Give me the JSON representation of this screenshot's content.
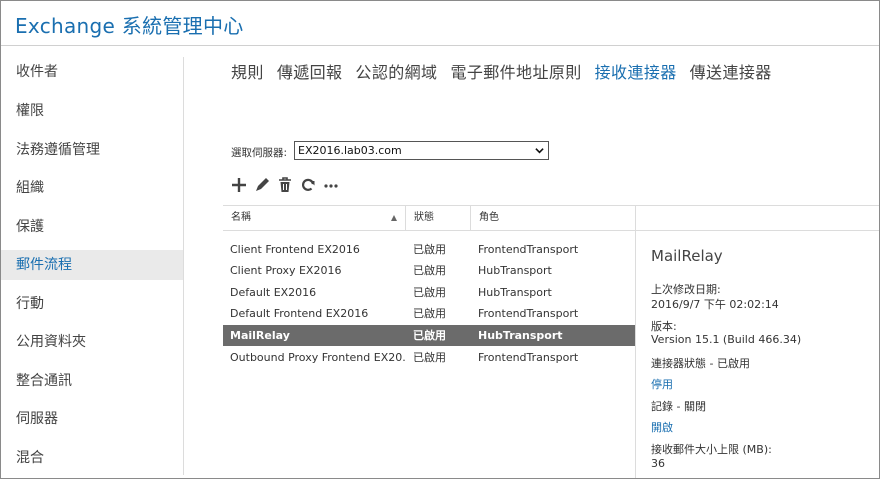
{
  "app": {
    "title": "Exchange 系統管理中心"
  },
  "sidebar": {
    "items": [
      {
        "label": "收件者"
      },
      {
        "label": "權限"
      },
      {
        "label": "法務遵循管理"
      },
      {
        "label": "組織"
      },
      {
        "label": "保護"
      },
      {
        "label": "郵件流程",
        "active": true
      },
      {
        "label": "行動"
      },
      {
        "label": "公用資料夾"
      },
      {
        "label": "整合通訊"
      },
      {
        "label": "伺服器"
      },
      {
        "label": "混合"
      }
    ]
  },
  "tabs": [
    {
      "label": "規則"
    },
    {
      "label": "傳遞回報"
    },
    {
      "label": "公認的網域"
    },
    {
      "label": "電子郵件地址原則"
    },
    {
      "label": "接收連接器",
      "active": true
    },
    {
      "label": "傳送連接器"
    }
  ],
  "server_picker": {
    "label": "選取伺服器:",
    "value": "EX2016.lab03.com"
  },
  "toolbar": {
    "icons": [
      "add-icon",
      "edit-icon",
      "delete-icon",
      "refresh-icon",
      "more-icon"
    ]
  },
  "grid": {
    "columns": {
      "name": "名稱",
      "status": "狀態",
      "role": "角色"
    },
    "rows": [
      {
        "name": "Client Frontend EX2016",
        "status": "已啟用",
        "role": "FrontendTransport"
      },
      {
        "name": "Client Proxy EX2016",
        "status": "已啟用",
        "role": "HubTransport"
      },
      {
        "name": "Default EX2016",
        "status": "已啟用",
        "role": "HubTransport"
      },
      {
        "name": "Default Frontend EX2016",
        "status": "已啟用",
        "role": "FrontendTransport"
      },
      {
        "name": "MailRelay",
        "status": "已啟用",
        "role": "HubTransport",
        "selected": true
      },
      {
        "name": "Outbound Proxy Frontend EX20...",
        "status": "已啟用",
        "role": "FrontendTransport"
      }
    ]
  },
  "details": {
    "title": "MailRelay",
    "modified_label": "上次修改日期:",
    "modified_value": "2016/9/7 下午 02:02:14",
    "version_label": "版本:",
    "version_value": "Version 15.1 (Build 466.34)",
    "connector_status": "連接器狀態 - 已啟用",
    "disable_link": "停用",
    "logging_status": "記錄 - 關閉",
    "enable_link": "開啟",
    "max_size_label": "接收郵件大小上限 (MB):",
    "max_size_value": "36"
  },
  "colors": {
    "accent": "#1a6fb0",
    "selected_row": "#6b6b6b",
    "active_nav": "#eaeaea"
  }
}
